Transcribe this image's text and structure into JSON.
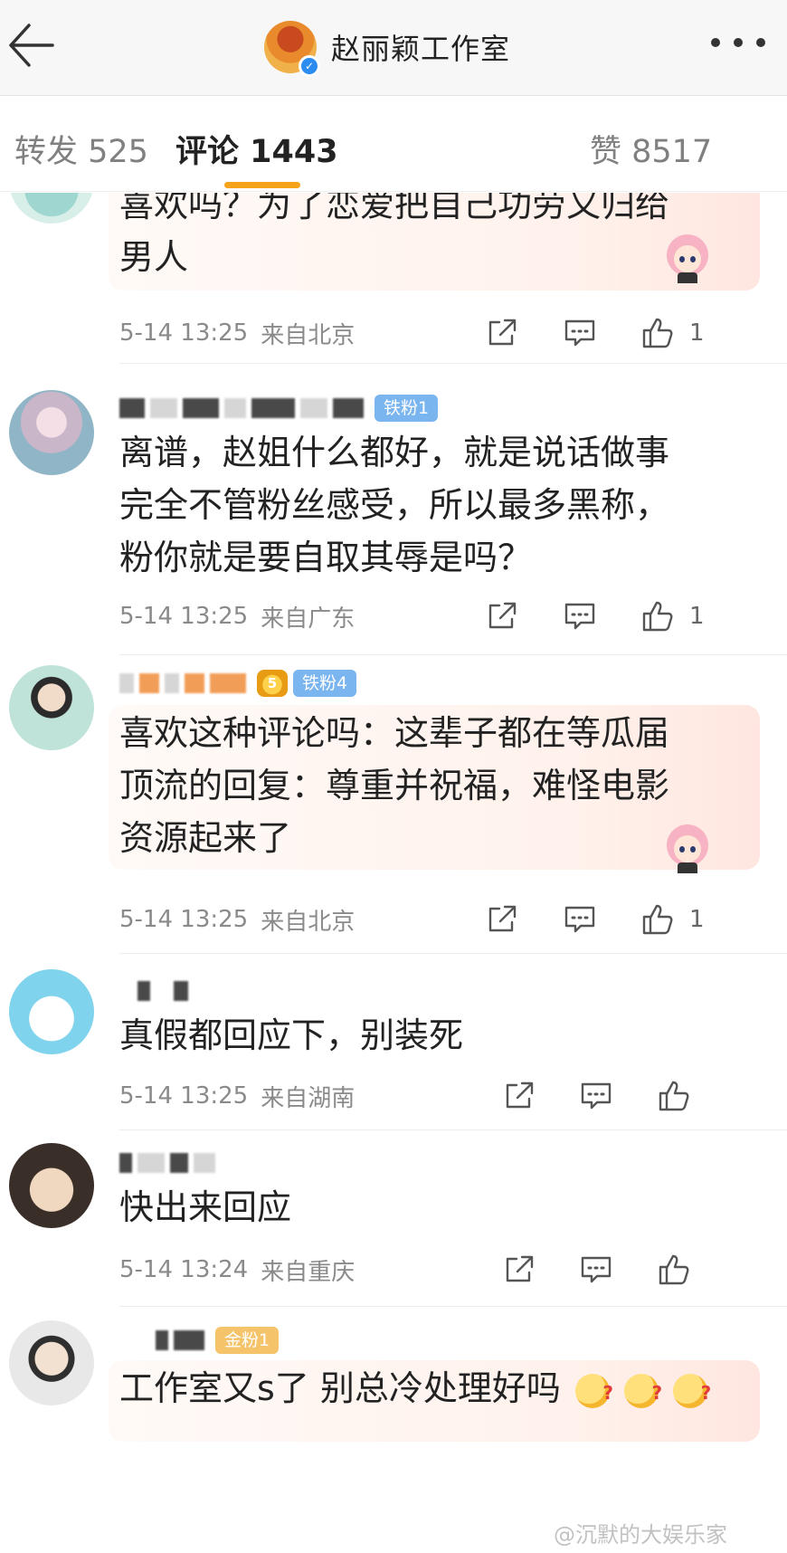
{
  "header": {
    "title": "赵丽颖工作室"
  },
  "tabs": [
    {
      "label": "转发 525"
    },
    {
      "label": "评论 1443"
    },
    {
      "label": "赞 8517"
    }
  ],
  "comments": [
    {
      "text_lines": [
        "喜欢吗？为了恋爱把自己功劳又归给",
        "男人"
      ],
      "time": "5-14 13:25",
      "location": "来自北京",
      "likes": "1"
    },
    {
      "badge": "铁粉1",
      "text_lines": [
        "离谱，赵姐什么都好，就是说话做事",
        "完全不管粉丝感受，所以最多黑称，",
        "粉你就是要自取其辱是吗？"
      ],
      "time": "5-14 13:25",
      "location": "来自广东",
      "likes": "1"
    },
    {
      "badge": "铁粉4",
      "crown_level": "5",
      "text_lines": [
        "喜欢这种评论吗：这辈子都在等瓜届",
        "顶流的回复：尊重并祝福，难怪电影",
        "资源起来了"
      ],
      "time": "5-14 13:25",
      "location": "来自北京",
      "likes": "1"
    },
    {
      "text_lines": [
        "真假都回应下，别装死"
      ],
      "time": "5-14 13:25",
      "location": "来自湖南",
      "likes": ""
    },
    {
      "text_lines": [
        "快出来回应"
      ],
      "time": "5-14 13:24",
      "location": "来自重庆",
      "likes": ""
    },
    {
      "badge": "金粉1",
      "text_lines": [
        "工作室又s了 别总冷处理好吗"
      ],
      "time": "",
      "location": "",
      "likes": ""
    }
  ],
  "watermark": "@沉默的大娱乐家",
  "colors": {
    "tab_underline": "#f7a21b",
    "badge_blue": "#7ab5f0",
    "badge_gold": "#f5c36a",
    "meta_text": "#8a8a8a"
  }
}
